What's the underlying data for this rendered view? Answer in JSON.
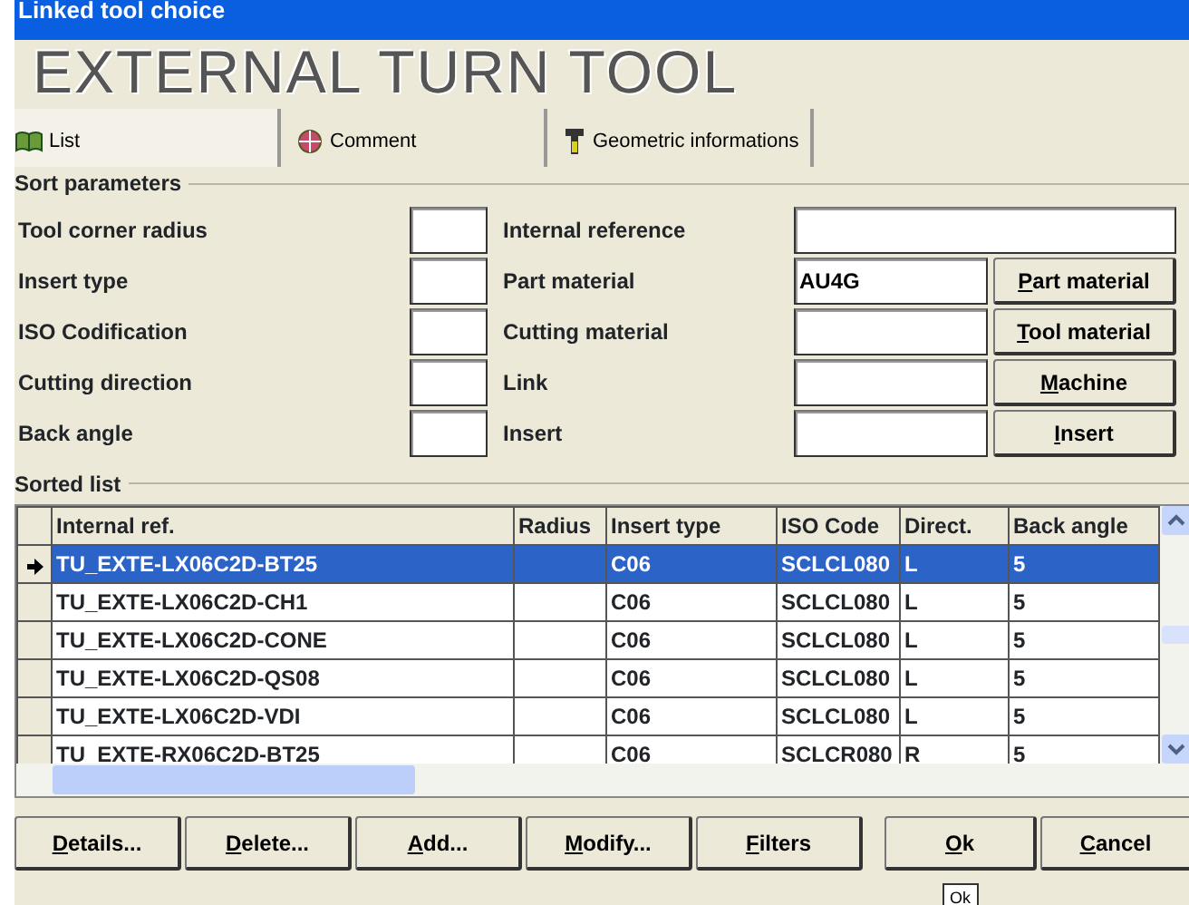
{
  "window": {
    "title": "Linked tool choice"
  },
  "heading": "EXTERNAL TURN TOOL",
  "tabs": [
    {
      "label": "List",
      "selected": true
    },
    {
      "label": "Comment",
      "selected": false
    },
    {
      "label": "Geometric informations",
      "selected": false
    }
  ],
  "sort_parameters": {
    "title": "Sort parameters",
    "left_fields": [
      {
        "label": "Tool corner radius"
      },
      {
        "label": "Insert type"
      },
      {
        "label": "ISO Codification"
      },
      {
        "label": "Cutting direction"
      },
      {
        "label": "Back angle"
      }
    ],
    "right_fields": [
      {
        "label": "Internal reference"
      },
      {
        "label": "Part material",
        "value": "AU4G"
      },
      {
        "label": "Cutting material"
      },
      {
        "label": "Link"
      },
      {
        "label": "Insert"
      }
    ],
    "buttons": [
      {
        "label": "Part material"
      },
      {
        "label": "Tool material"
      },
      {
        "label": "Machine"
      },
      {
        "label": "Insert"
      }
    ]
  },
  "sorted_list": {
    "title": "Sorted list",
    "columns": [
      "Internal ref.",
      "Radius",
      "Insert type",
      "ISO Code",
      "Direct.",
      "Back angle"
    ],
    "rows": [
      {
        "selected": true,
        "cells": [
          "TU_EXTE-LX06C2D-BT25",
          "",
          "C06",
          "SCLCL080",
          "L",
          "5"
        ]
      },
      {
        "selected": false,
        "cells": [
          "TU_EXTE-LX06C2D-CH1",
          "",
          "C06",
          "SCLCL080",
          "L",
          "5"
        ]
      },
      {
        "selected": false,
        "cells": [
          "TU_EXTE-LX06C2D-CONE",
          "",
          "C06",
          "SCLCL080",
          "L",
          "5"
        ]
      },
      {
        "selected": false,
        "cells": [
          "TU_EXTE-LX06C2D-QS08",
          "",
          "C06",
          "SCLCL080",
          "L",
          "5"
        ]
      },
      {
        "selected": false,
        "cells": [
          "TU_EXTE-LX06C2D-VDI",
          "",
          "C06",
          "SCLCL080",
          "L",
          "5"
        ]
      },
      {
        "selected": false,
        "cells": [
          "TU_EXTE-RX06C2D-BT25",
          "",
          "C06",
          "SCLCR080",
          "R",
          "5"
        ]
      }
    ]
  },
  "actions": [
    {
      "label": "Details..."
    },
    {
      "label": "Delete..."
    },
    {
      "label": "Add..."
    },
    {
      "label": "Modify..."
    },
    {
      "label": "Filters"
    }
  ],
  "dialog_buttons": [
    {
      "label": "Ok"
    },
    {
      "label": "Cancel"
    }
  ],
  "background_button": {
    "label": "Ok"
  }
}
